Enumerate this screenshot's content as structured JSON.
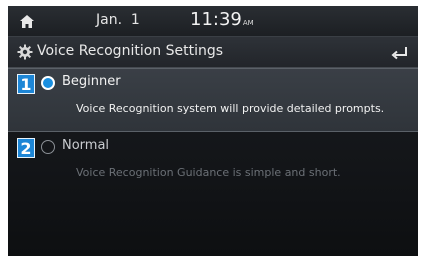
{
  "status_bar": {
    "date": "Jan.  1",
    "time": "11:39",
    "ampm": "AM"
  },
  "header": {
    "title": "Voice Recognition Settings"
  },
  "options": [
    {
      "number": "1",
      "label": "Beginner",
      "description": "Voice Recognition system will provide detailed prompts.",
      "selected": true
    },
    {
      "number": "2",
      "label": "Normal",
      "description": "Voice Recognition Guidance is simple and short.",
      "selected": false
    }
  ],
  "colors": {
    "accent": "#1d86d6",
    "background": "#121417",
    "selected_row": "#353a40"
  },
  "icons": {
    "home": "home-icon",
    "settings": "gear-icon",
    "back": "back-arrow-icon"
  }
}
